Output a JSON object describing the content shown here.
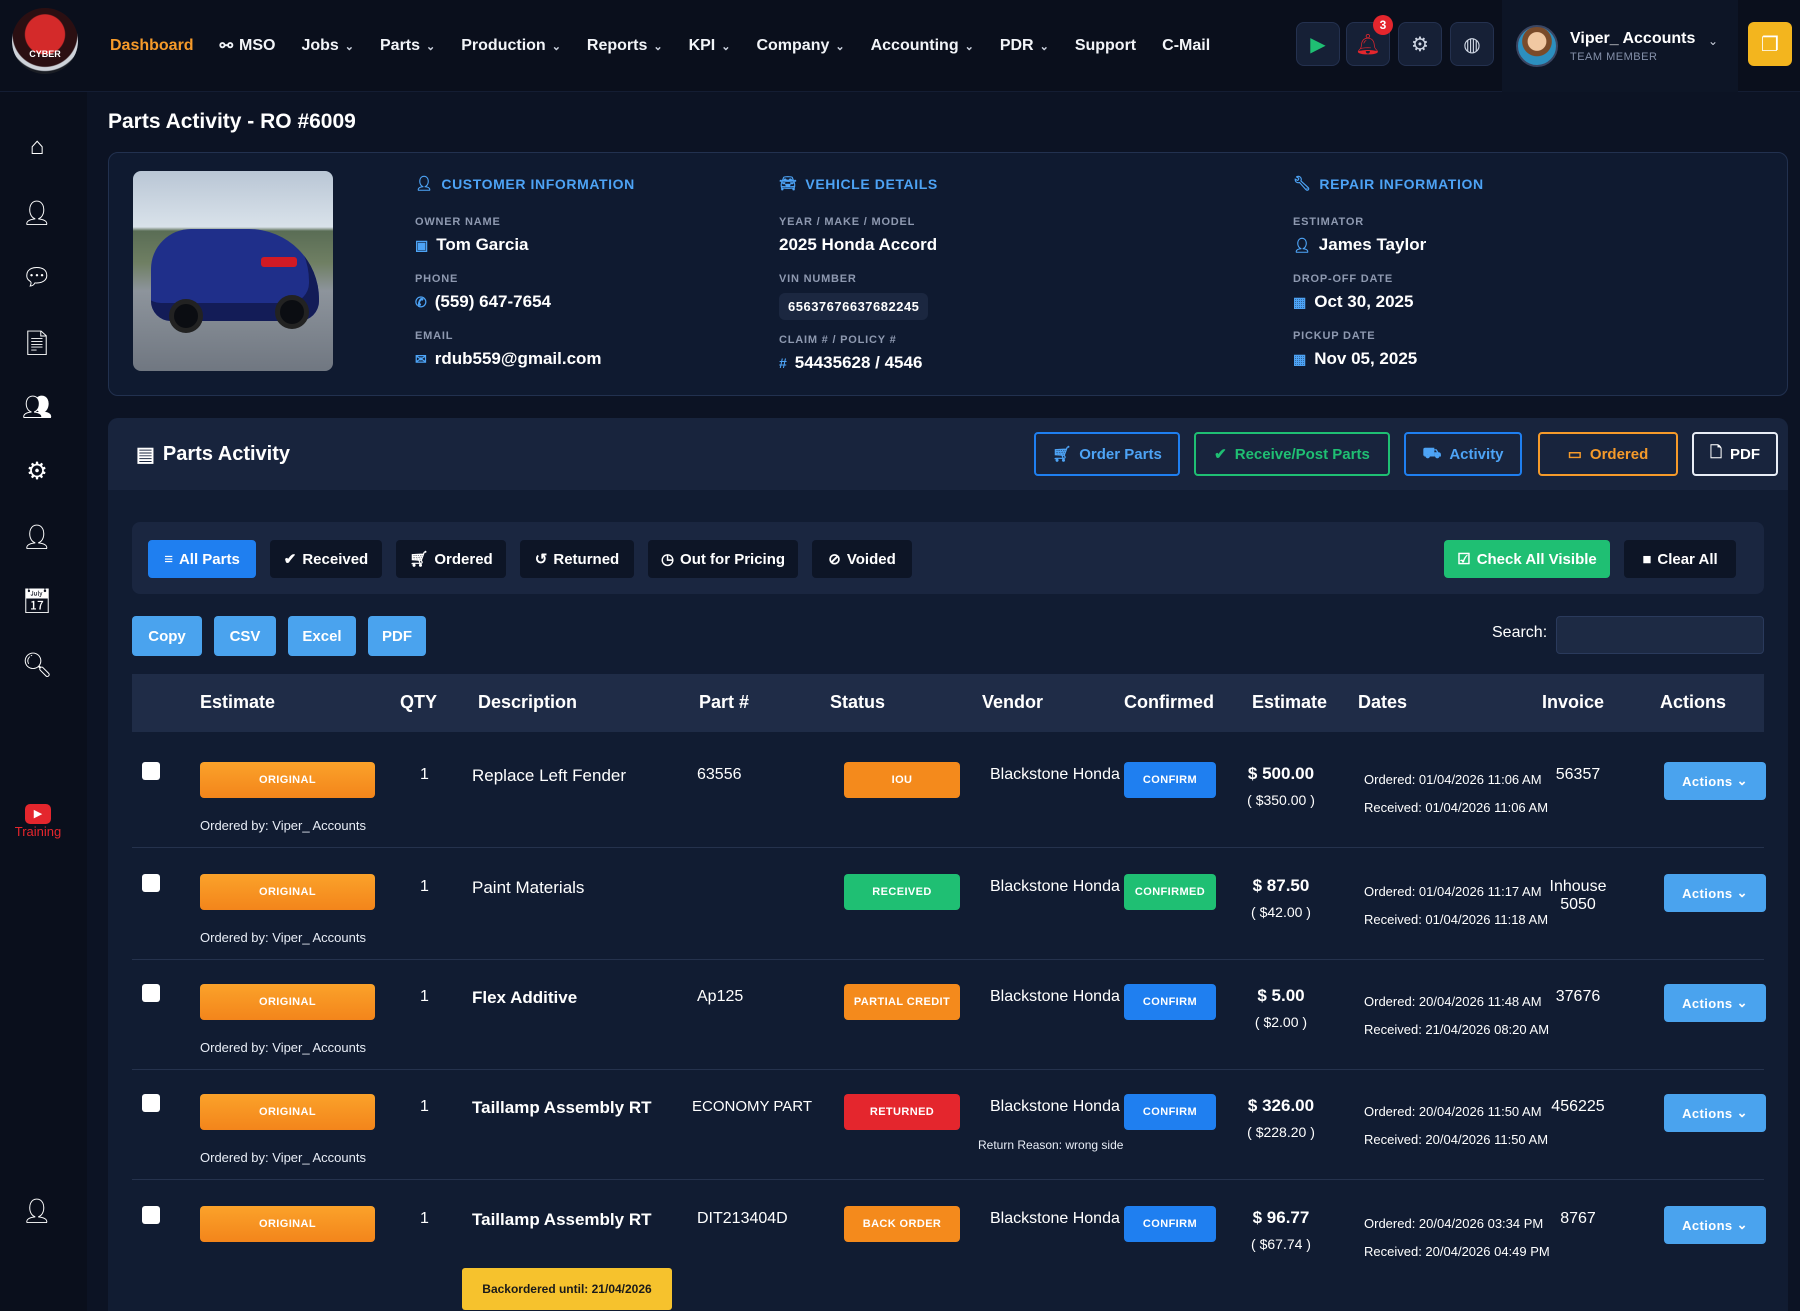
{
  "nav": {
    "items": [
      "Dashboard",
      "MSO",
      "Jobs",
      "Parts",
      "Production",
      "Reports",
      "KPI",
      "Company",
      "Accounting",
      "PDR",
      "Support",
      "C-Mail"
    ],
    "notification_count": "3"
  },
  "user": {
    "name": "Viper_ Accounts",
    "role": "TEAM MEMBER"
  },
  "logo_text": "CYBER",
  "sidebar": {
    "training": "Training"
  },
  "page": {
    "title": "Parts Activity - RO #6009"
  },
  "customer": {
    "heading": "CUSTOMER INFORMATION",
    "owner_label": "OWNER NAME",
    "owner": "Tom Garcia",
    "phone_label": "PHONE",
    "phone": "(559) 647-7654",
    "email_label": "EMAIL",
    "email": "rdub559@gmail.com"
  },
  "vehicle": {
    "heading": "VEHICLE DETAILS",
    "ymm_label": "YEAR / MAKE / MODEL",
    "ymm": "2025 Honda Accord",
    "vin_label": "VIN NUMBER",
    "vin": "65637676637682245",
    "claim_label": "CLAIM # / POLICY #",
    "claim": "54435628 / 4546"
  },
  "repair": {
    "heading": "REPAIR INFORMATION",
    "estimator_label": "ESTIMATOR",
    "estimator": "James Taylor",
    "dropoff_label": "DROP-OFF DATE",
    "dropoff": "Oct 30, 2025",
    "pickup_label": "PICKUP DATE",
    "pickup": "Nov 05, 2025"
  },
  "parts_panel": {
    "title": "Parts Activity",
    "buttons": {
      "order": "Order Parts",
      "receive": "Receive/Post Parts",
      "activity": "Activity",
      "ordered": "Ordered",
      "pdf": "PDF"
    }
  },
  "filters": {
    "all": "All Parts",
    "received": "Received",
    "ordered": "Ordered",
    "returned": "Returned",
    "pricing": "Out for Pricing",
    "voided": "Voided",
    "check_all": "Check All Visible",
    "clear_all": "Clear All"
  },
  "export": {
    "copy": "Copy",
    "csv": "CSV",
    "excel": "Excel",
    "pdf": "PDF"
  },
  "search": {
    "label": "Search:"
  },
  "table": {
    "headers": [
      "Estimate",
      "QTY",
      "Description",
      "Part #",
      "Status",
      "Vendor",
      "Confirmed",
      "Estimate",
      "Dates",
      "Invoice",
      "Actions"
    ],
    "rows": [
      {
        "estimate_tag": "ORIGINAL",
        "ordered_by": "Ordered by: Viper_ Accounts",
        "qty": "1",
        "description": "Replace Left Fender",
        "part": "63556",
        "status": "IOU",
        "vendor": "Blackstone Honda",
        "confirmed": "CONFIRM",
        "est": "$ 500.00",
        "cost": "( $350.00 )",
        "ordered": "Ordered: 01/04/2026 11:06 AM",
        "received": "Received: 01/04/2026 11:06 AM",
        "invoice": "56357",
        "actions": "Actions"
      },
      {
        "estimate_tag": "ORIGINAL",
        "ordered_by": "Ordered by: Viper_ Accounts",
        "qty": "1",
        "description": "Paint Materials",
        "part": "",
        "status": "RECEIVED",
        "vendor": "Blackstone Honda",
        "confirmed": "CONFIRMED",
        "est": "$ 87.50",
        "cost": "( $42.00 )",
        "ordered": "Ordered: 01/04/2026 11:17 AM",
        "received": "Received: 01/04/2026 11:18 AM",
        "invoice": "Inhouse 5050",
        "actions": "Actions"
      },
      {
        "estimate_tag": "ORIGINAL",
        "ordered_by": "Ordered by: Viper_ Accounts",
        "qty": "1",
        "description": "Flex Additive",
        "part": "Ap125",
        "status": "PARTIAL CREDIT",
        "vendor": "Blackstone Honda",
        "confirmed": "CONFIRM",
        "est": "$ 5.00",
        "cost": "( $2.00 )",
        "ordered": "Ordered: 20/04/2026 11:48 AM",
        "received": "Received: 21/04/2026 08:20 AM",
        "invoice": "37676",
        "actions": "Actions"
      },
      {
        "estimate_tag": "ORIGINAL",
        "ordered_by": "Ordered by: Viper_ Accounts",
        "qty": "1",
        "description": "Taillamp Assembly RT",
        "part": "ECONOMY PART",
        "status": "RETURNED",
        "vendor": "Blackstone Honda",
        "return_reason": "Return Reason: wrong side",
        "confirmed": "CONFIRM",
        "est": "$ 326.00",
        "cost": "( $228.20 )",
        "ordered": "Ordered: 20/04/2026 11:50 AM",
        "received": "Received: 20/04/2026 11:50 AM",
        "invoice": "456225",
        "actions": "Actions"
      },
      {
        "estimate_tag": "ORIGINAL",
        "backorder": "Backordered until: 21/04/2026",
        "qty": "1",
        "description": "Taillamp Assembly RT",
        "part": "DIT213404D",
        "status": "BACK ORDER",
        "vendor": "Blackstone Honda",
        "confirmed": "CONFIRM",
        "est": "$ 96.77",
        "cost": "( $67.74 )",
        "ordered": "Ordered: 20/04/2026 03:34 PM",
        "received": "Received: 20/04/2026 04:49 PM",
        "invoice": "8767",
        "actions": "Actions"
      }
    ]
  },
  "colors": {
    "accent": "#4da3f5",
    "orange": "#f59a2a",
    "green": "#1fbf73",
    "red": "#e4262d",
    "blue": "#1f7ff0"
  }
}
